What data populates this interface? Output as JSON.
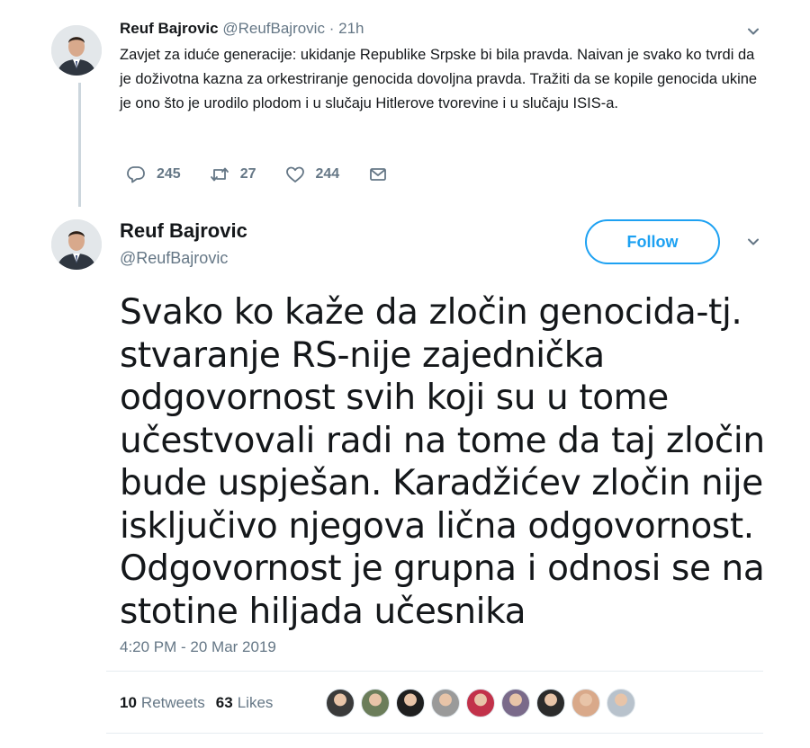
{
  "reply_tweet": {
    "name": "Reuf Bajrovic",
    "handle": "@ReufBajrovic",
    "separator": "·",
    "time": "21h",
    "text": "Zavjet za iduće generacije: ukidanje Republike Srpske bi bila pravda. Naivan je svako ko tvrdi da je doživotna kazna za orkestriranje genocida dovoljna pravda. Tražiti da se kopile genocida ukine je ono što je urodilo plodom i u slučaju Hitlerove tvorevine i u slučaju ISIS-a.",
    "actions": {
      "replies": "245",
      "retweets": "27",
      "likes": "244"
    },
    "icons": [
      "reply-icon",
      "retweet-icon",
      "heart-icon",
      "message-icon",
      "chevron-down-icon"
    ]
  },
  "main_tweet": {
    "name": "Reuf Bajrovic",
    "handle": "@ReufBajrovic",
    "follow_label": "Follow",
    "text": "Svako ko kaže da zločin genocida-tj. stvaranje RS-nije zajednička odgovornost svih koji su u tome učestvovali radi na tome da taj zločin bude uspješan. Karadžićev zločin nije isključivo njegova lična odgovornost. Odgovornost je grupna i odnosi se na stotine hiljada učesnika",
    "timestamp": "4:20 PM - 20 Mar 2019",
    "stats": {
      "retweets_count": "10",
      "retweets_label": "Retweets",
      "likes_count": "63",
      "likes_label": "Likes"
    }
  },
  "colors": {
    "accent": "#1da1f2",
    "muted": "#657786",
    "text": "#14171a",
    "border": "#e6ecf0"
  },
  "liker_avatars": [
    {
      "color": "#3a3a3a"
    },
    {
      "color": "#6b7d5a"
    },
    {
      "color": "#1f1f1f"
    },
    {
      "color": "#9a9a9a"
    },
    {
      "color": "#c2324a"
    },
    {
      "color": "#7a6a8a"
    },
    {
      "color": "#2b2b2b"
    },
    {
      "color": "#d9a98a"
    },
    {
      "color": "#b8c2cc"
    }
  ]
}
